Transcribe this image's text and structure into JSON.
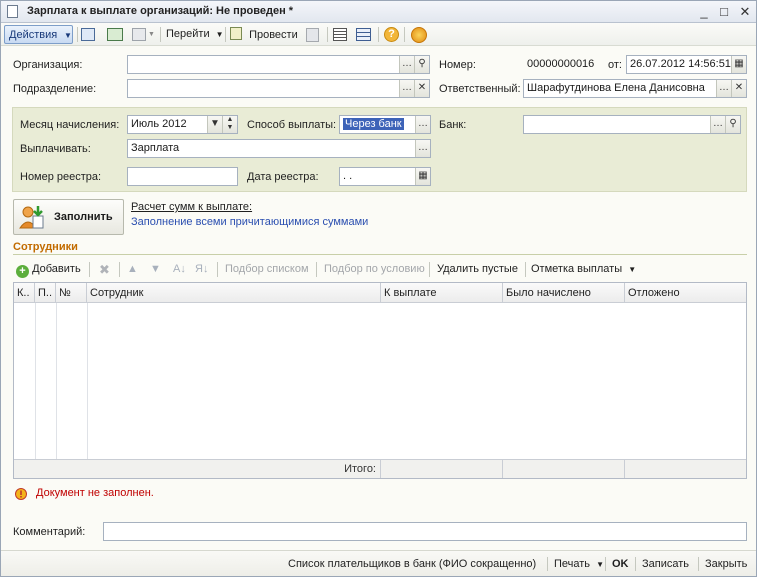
{
  "window": {
    "title": "Зарплата к выплате организаций: Не проведен *",
    "controls": {
      "minimize": "_",
      "maximize": "□",
      "close": "✕"
    }
  },
  "toolbar": {
    "actions_label": "Действия",
    "goto_label": "Перейти",
    "post_label": "Провести"
  },
  "header": {
    "organization_label": "Организация:",
    "organization_value": "",
    "subdivision_label": "Подразделение:",
    "subdivision_value": "",
    "number_label": "Номер:",
    "number_value": "00000000016",
    "date_label": "от:",
    "date_value": "26.07.2012 14:56:51",
    "responsible_label": "Ответственный:",
    "responsible_value": "Шарафутдинова Елена Данисовна"
  },
  "panel": {
    "month_label": "Месяц начисления:",
    "month_value": "Июль 2012",
    "payment_method_label": "Способ выплаты:",
    "payment_method_value": "Через банк",
    "bank_label": "Банк:",
    "bank_value": "",
    "pay_label": "Выплачивать:",
    "pay_value": "Зарплата",
    "registry_number_label": "Номер реестра:",
    "registry_number_value": "",
    "registry_date_label": "Дата реестра:",
    "registry_date_value": " .  . "
  },
  "fill": {
    "button_label": "Заполнить",
    "calc_link": "Расчет сумм к выплате:",
    "fill_link": "Заполнение всеми причитающимися суммами"
  },
  "employees": {
    "section_title": "Сотрудники",
    "toolbar": {
      "add": "Добавить",
      "pick_list": "Подбор списком",
      "pick_condition": "Подбор по условию",
      "delete_empty": "Удалить пустые",
      "payment_mark": "Отметка выплаты"
    },
    "columns": [
      "К..",
      "П..",
      "№",
      "Сотрудник",
      "К выплате",
      "Было начислено",
      "Отложено"
    ],
    "rows": [],
    "total_label": "Итого:"
  },
  "warning": {
    "text": "Документ не заполнен."
  },
  "comment": {
    "label": "Комментарий:",
    "value": ""
  },
  "bottom_bar": {
    "payers_list": "Список плательщиков в банк (ФИО сокращенно)",
    "print": "Печать",
    "ok": "OK",
    "save": "Записать",
    "close": "Закрыть"
  },
  "colors": {
    "panel_bg": "#e9ecd6",
    "section_title": "#c26b00",
    "link": "#2b4fb0",
    "warning": "#c00000",
    "selected": "#3d63b8"
  },
  "icons": [
    "document-icon",
    "calculator-icon",
    "help-icon",
    "search-icon",
    "clear-icon",
    "calendar-icon",
    "add-icon",
    "delete-icon",
    "warning-icon"
  ]
}
